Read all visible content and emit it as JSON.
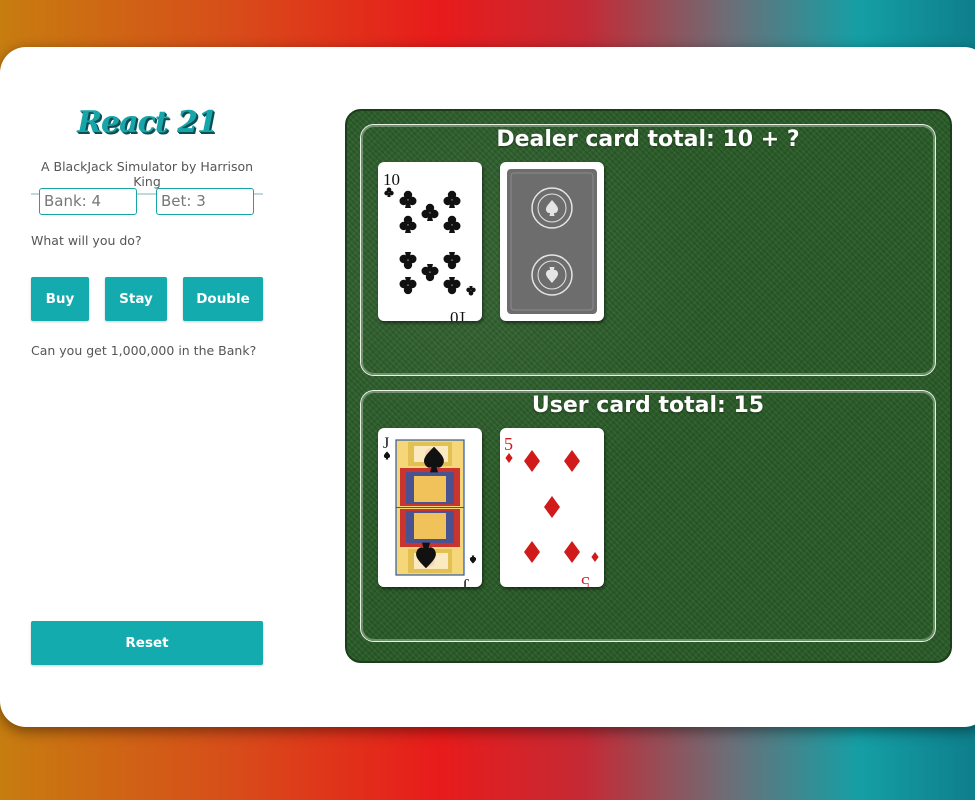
{
  "app": {
    "logo": "React 21",
    "subtitle": "A BlackJack Simulator by Harrison King"
  },
  "stats": {
    "bank": "Bank: 4",
    "bet": "Bet: 3"
  },
  "prompt": "What will you do?",
  "actions": {
    "buy": "Buy",
    "stay": "Stay",
    "double": "Double",
    "reset": "Reset"
  },
  "challenge": "Can you get 1,000,000 in the Bank?",
  "dealer": {
    "title": "Dealer card total: 10 + ?",
    "cards": [
      {
        "rank": "10",
        "suit": "clubs",
        "face_up": true
      },
      {
        "rank": "",
        "suit": "",
        "face_up": false
      }
    ]
  },
  "user": {
    "title": "User card total: 15",
    "cards": [
      {
        "rank": "J",
        "suit": "spades",
        "face_up": true
      },
      {
        "rank": "5",
        "suit": "diamonds",
        "face_up": true
      }
    ]
  },
  "colors": {
    "accent": "#14abae",
    "felt": "#2a5c28",
    "red_suit": "#d11a1a",
    "card_back": "#6d6d6d"
  }
}
